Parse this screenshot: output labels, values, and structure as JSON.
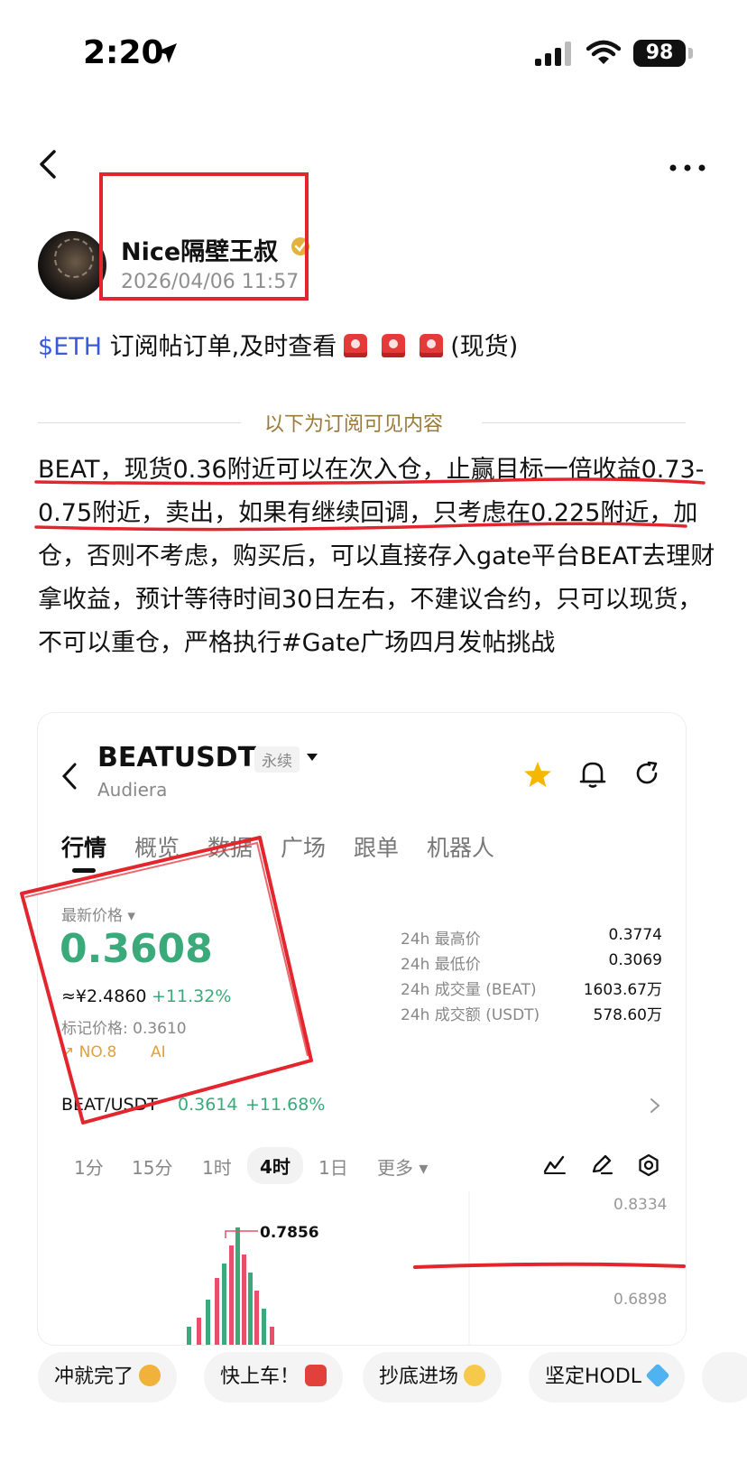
{
  "status": {
    "time": "2:20",
    "battery": "98"
  },
  "author": {
    "name": "Nice隔壁王叔",
    "time": "2026/04/06 11:57"
  },
  "post": {
    "ticker": "$ETH",
    "title_text": " 订阅帖订单,及时查看",
    "title_suffix": "(现货)",
    "divider_label": "以下为订阅可见内容",
    "body": "BEAT，现货0.36附近可以在次入仓，止赢目标一倍收益0.73-0.75附近，卖出，如果有继续回调，只考虑在0.225附近，加仓，否则不考虑，购买后，可以直接存入gate平台BEAT去理财拿收益，预计等待时间30日左右，不建议合约，只可以现货，不可以重仓，严格执行#Gate广场四月发帖挑战"
  },
  "card": {
    "symbol": "BEATUSDT",
    "badge": "永续",
    "subtitle": "Audiera",
    "tabs": [
      "行情",
      "概览",
      "数据",
      "广场",
      "跟单",
      "机器人"
    ],
    "latest_label": "最新价格 ▾",
    "price": "0.3608",
    "cny": "≈¥2.4860",
    "change": "+11.32%",
    "mark_price": "标记价格: 0.3610",
    "rank": "↗ NO.8",
    "ai": "AI",
    "stats": [
      {
        "label": "24h 最高价",
        "value": "0.3774"
      },
      {
        "label": "24h 最低价",
        "value": "0.3069"
      },
      {
        "label": "24h 成交量 (BEAT)",
        "value": "1603.67万"
      },
      {
        "label": "24h 成交额 (USDT)",
        "value": "578.60万"
      }
    ],
    "pair": "BEAT/USDT",
    "pair_price": "0.3614",
    "pair_change": "+11.68%",
    "intervals": [
      "1分",
      "15分",
      "1时",
      "4时",
      "1日",
      "更多 ▾"
    ],
    "active_interval": "4时",
    "y_labels": [
      "0.8334",
      "0.6898"
    ],
    "peak_label": "0.7856",
    "colors": {
      "up": "#3aaa7a",
      "down": "#e8506a",
      "accent": "#f5b800"
    }
  },
  "quick_replies": [
    {
      "label": "冲就完了",
      "emoji": "fist"
    },
    {
      "label": "快上车！",
      "emoji": "car"
    },
    {
      "label": "抄底进场",
      "emoji": "sunglasses-face"
    },
    {
      "label": "坚定HODL",
      "emoji": "gem"
    }
  ]
}
